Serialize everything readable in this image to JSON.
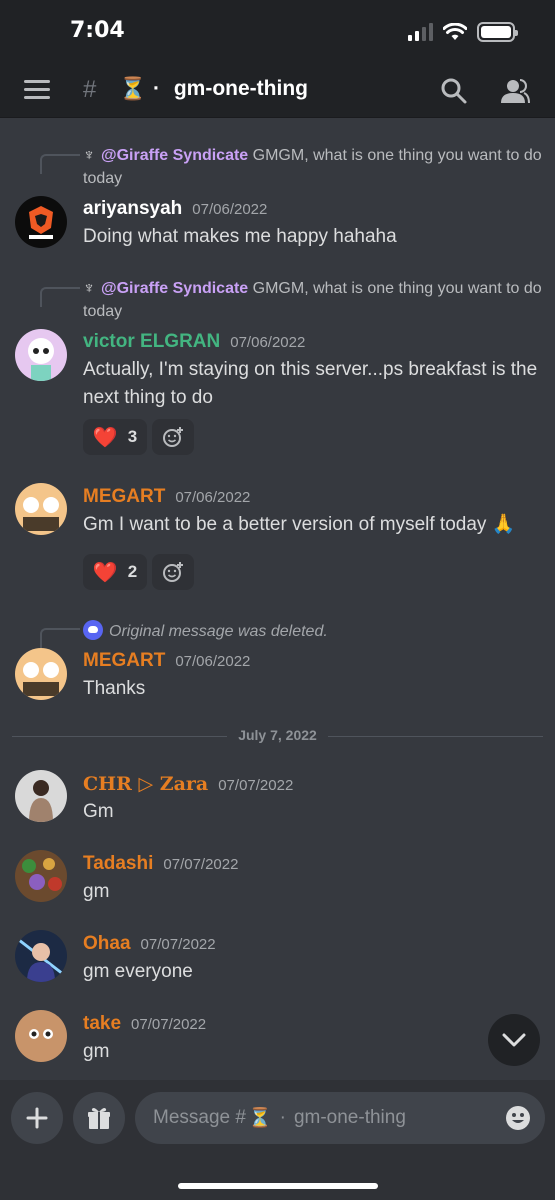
{
  "status_bar": {
    "time": "7:04"
  },
  "header": {
    "channel_name": "gm-one-thing",
    "channel_emoji": "⏳",
    "separator": "·"
  },
  "messages": [
    {
      "reply": {
        "mention": "@Giraffe Syndicate",
        "text": "GMGM, what is one thing you want to do today"
      },
      "author": "ariyansyah",
      "author_color": "#ffffff",
      "timestamp": "07/06/2022",
      "text": "Doing what makes me happy hahaha"
    },
    {
      "reply": {
        "mention": "@Giraffe Syndicate",
        "text": "GMGM, what is one thing you want to do today"
      },
      "author": "victor ELGRAN",
      "author_color": "#43b581",
      "timestamp": "07/06/2022",
      "text": "Actually, I'm staying on this server...ps breakfast is the next thing to do",
      "reaction": {
        "emoji": "❤️",
        "count": "3"
      }
    },
    {
      "author": "MEGART",
      "author_color": "#e67e22",
      "timestamp": "07/06/2022",
      "text": "Gm I want to  be a better version of myself today 🙏",
      "reaction": {
        "emoji": "❤️",
        "count": "2"
      }
    },
    {
      "deleted_reply": "Original message was deleted.",
      "author": "MEGART",
      "author_color": "#e67e22",
      "timestamp": "07/06/2022",
      "text": "Thanks"
    },
    {
      "author": "CHR ▷ Zara",
      "author_color": "#e67e22",
      "timestamp": "07/07/2022",
      "text": "Gm"
    },
    {
      "author": "Tadashi",
      "author_color": "#e67e22",
      "timestamp": "07/07/2022",
      "text": "gm"
    },
    {
      "author": "Ohaa",
      "author_color": "#e67e22",
      "timestamp": "07/07/2022",
      "text": "gm everyone"
    },
    {
      "author": "take",
      "author_color": "#e67e22",
      "timestamp": "07/07/2022",
      "text": "gm"
    }
  ],
  "date_divider": "July 7, 2022",
  "composer": {
    "placeholder_prefix": "Message #",
    "placeholder_emoji": "⏳",
    "placeholder_separator": "·",
    "placeholder_channel": "gm-one-thing"
  },
  "icons": {
    "menu": "hamburger-icon",
    "search": "search-icon",
    "members": "members-icon",
    "add": "plus-icon",
    "gift": "gift-icon",
    "emoji": "smiley-icon",
    "scroll": "chevron-down-icon"
  }
}
